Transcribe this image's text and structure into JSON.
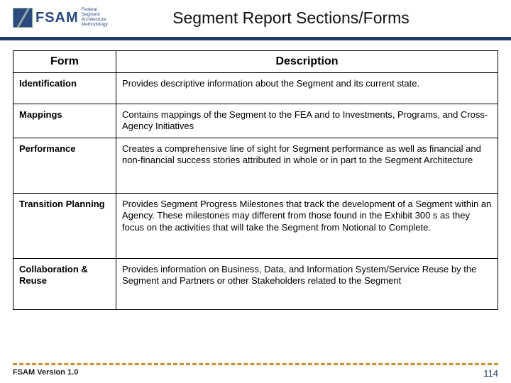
{
  "logo": {
    "acronym": "FSAM",
    "subtitle_line1": "Federal",
    "subtitle_line2": "Segment",
    "subtitle_line3": "Architecture",
    "subtitle_line4": "Methodology"
  },
  "title": "Segment Report Sections/Forms",
  "table": {
    "headers": {
      "form": "Form",
      "description": "Description"
    },
    "rows": [
      {
        "form": "Identification",
        "description": "Provides descriptive information about the Segment and its current state."
      },
      {
        "form": "Mappings",
        "description": "Contains mappings of the Segment to the FEA and to Investments, Programs, and Cross-Agency Initiatives"
      },
      {
        "form": "Performance",
        "description": "Creates a comprehensive line of sight for Segment performance as well as financial and non-financial success stories attributed in whole or in part to the Segment Architecture"
      },
      {
        "form": "Transition Planning",
        "description": "Provides Segment Progress Milestones that track the development of a Segment within an Agency.  These milestones may different from those found in the Exhibit 300 s as they focus on the activities that will take the Segment from Notional to Complete."
      },
      {
        "form": "Collaboration & Reuse",
        "description": "Provides information on Business, Data, and Information System/Service Reuse by the Segment and Partners or other Stakeholders related to the Segment"
      }
    ]
  },
  "footer": {
    "version": "FSAM Version 1.0",
    "page": "114"
  }
}
